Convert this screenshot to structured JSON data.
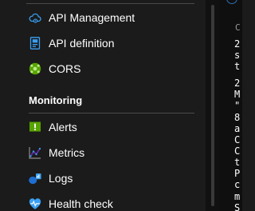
{
  "nav": {
    "items_top": [
      {
        "id": "api-management",
        "label": "API Management",
        "icon": "cloud-gear-icon"
      },
      {
        "id": "api-definition",
        "label": "API definition",
        "icon": "api-doc-icon"
      },
      {
        "id": "cors",
        "label": "CORS",
        "icon": "cors-globe-icon"
      }
    ],
    "monitoring_header": "Monitoring",
    "items_monitoring": [
      {
        "id": "alerts",
        "label": "Alerts",
        "icon": "alert-icon"
      },
      {
        "id": "metrics",
        "label": "Metrics",
        "icon": "metrics-chart-icon"
      },
      {
        "id": "logs",
        "label": "Logs",
        "icon": "logs-icon"
      },
      {
        "id": "health-check",
        "label": "Health check",
        "icon": "heart-pulse-icon"
      }
    ]
  },
  "content": {
    "heading_fragment": "C",
    "log_fragments": [
      "2",
      "s",
      "t",
      "2",
      "M",
      "\"",
      "8",
      "a",
      "C",
      "C",
      "t",
      "P",
      "c",
      "m",
      "S"
    ]
  },
  "colors": {
    "background": "#1b1b1b",
    "text": "#ffffff",
    "divider": "#4a4a4a",
    "accent_blue": "#2f6fb3",
    "alert_green": "#57a300",
    "health_blue": "#3aa0f3"
  }
}
